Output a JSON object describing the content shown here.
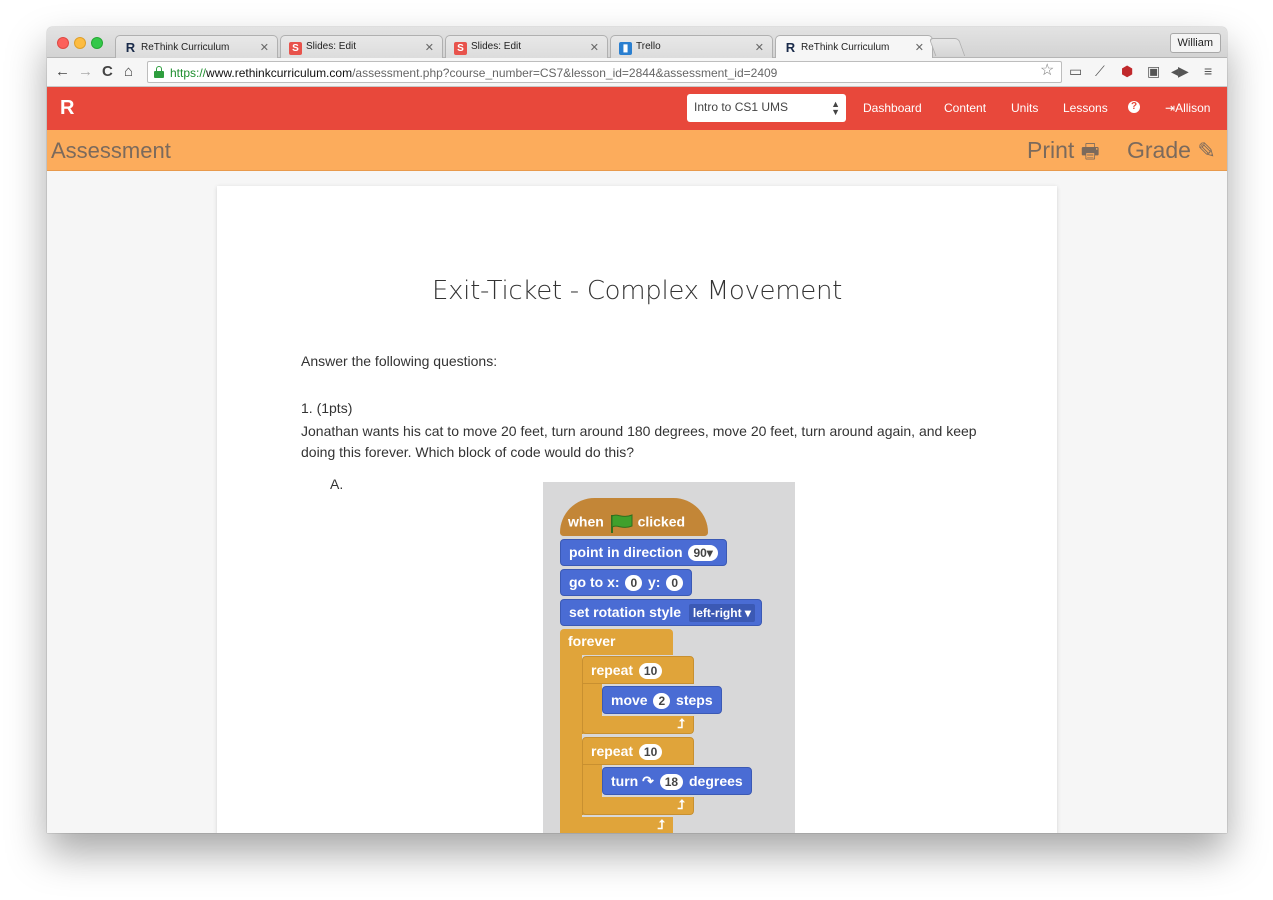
{
  "browser": {
    "tabs": [
      {
        "label": "ReThink Curriculum",
        "favicon": "rethink-logo-icon"
      },
      {
        "label": "Slides: Edit",
        "favicon": "slides-icon"
      },
      {
        "label": "Slides: Edit",
        "favicon": "slides-icon"
      },
      {
        "label": "Trello",
        "favicon": "trello-icon"
      },
      {
        "label": "ReThink Curriculum",
        "favicon": "rethink-logo-icon",
        "active": true
      }
    ],
    "profile_name": "William",
    "url": {
      "scheme": "https://",
      "host": "www.rethinkcurriculum.com",
      "path": "/assessment.php?course_number=CS7&lesson_id=2844&assessment_id=2409"
    }
  },
  "appbar": {
    "brand": "R",
    "course_select": "Intro to CS1 UMS",
    "links": [
      "Dashboard",
      "Content",
      "Units",
      "Lessons"
    ],
    "help_glyph": "?",
    "user": "Allison",
    "accent_color": "#e8483b"
  },
  "subheader": {
    "title": "Assessment",
    "print_label": "Print",
    "grade_label": "Grade",
    "color": "#fcac5c"
  },
  "assessment": {
    "title": "Exit-Ticket - Complex Movement",
    "instructions": "Answer the following questions:",
    "questions": [
      {
        "number": "1. (1pts)",
        "text": "Jonathan wants his cat to move 20 feet, turn around 180 degrees, move 20 feet, turn around again, and keep doing this forever. Which block of code would do this?",
        "options": [
          {
            "label": "A.",
            "scratch_blocks": {
              "when": "when",
              "clicked": "clicked",
              "point": "point in direction",
              "point_value": "90▾",
              "goto": "go to x:",
              "x": "0",
              "y_label": "y:",
              "y": "0",
              "rotation": "set rotation style",
              "rotation_value": "left-right ▾",
              "forever": "forever",
              "repeat1": "repeat",
              "repeat1_value": "10",
              "move": "move",
              "move_value": "2",
              "steps": "steps",
              "repeat2": "repeat",
              "repeat2_value": "10",
              "turn": "turn",
              "turn_value": "18",
              "degrees": "degrees"
            }
          }
        ]
      }
    ]
  }
}
